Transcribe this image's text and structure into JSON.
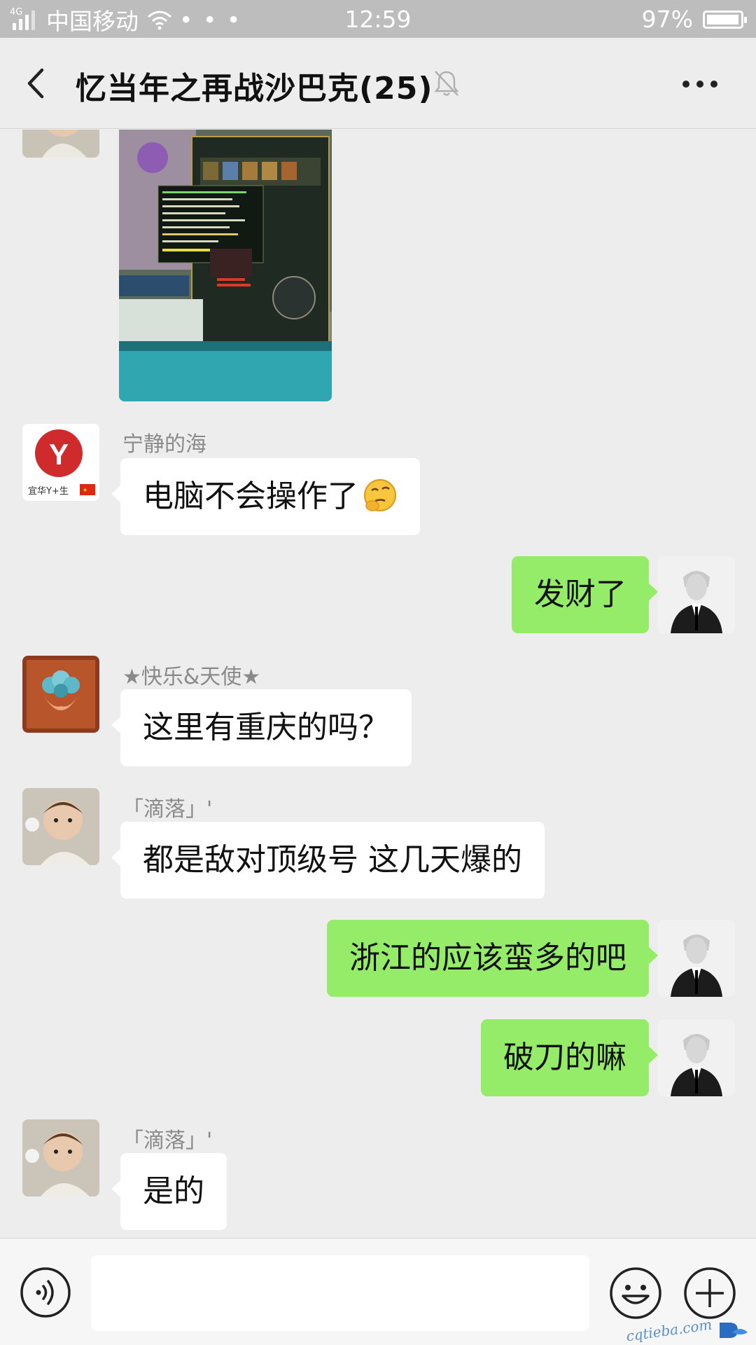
{
  "status_bar": {
    "network": "4G",
    "carrier": "中国移动",
    "more_dots": "• • •",
    "time": "12:59",
    "battery": "97%",
    "battery_level": 0.97
  },
  "header": {
    "title": "忆当年之再战沙巴克(25)"
  },
  "messages": {
    "m1": {
      "sender": "宁静的海",
      "text": "电脑不会操作了"
    },
    "m2": {
      "text": "发财了"
    },
    "m3": {
      "sender": "★快乐&天使★",
      "text": "这里有重庆的吗？"
    },
    "m4": {
      "sender": "「滴落」'",
      "text": "都是敌对顶级号 这几天爆的"
    },
    "m5": {
      "text": "浙江的应该蛮多的吧"
    },
    "m6": {
      "text": "破刀的嘛"
    },
    "m7": {
      "sender": "「滴落」'",
      "text": "是的"
    }
  },
  "avatars": {
    "ningjing_logo": "Y",
    "ningjing_caption": "宜华Y+生"
  },
  "input": {
    "value": ""
  },
  "watermark": {
    "text": "cqtieba.com"
  },
  "colors": {
    "background": "#ededed",
    "incoming_bubble": "#ffffff",
    "outgoing_bubble": "#95ec69",
    "sender_name": "#8a8a8a"
  }
}
